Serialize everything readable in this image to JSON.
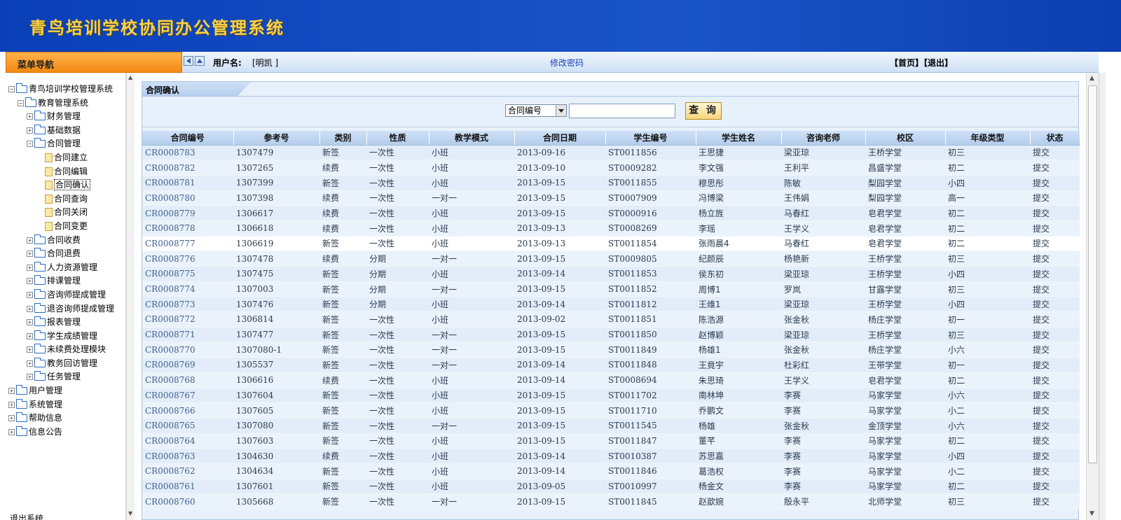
{
  "app": {
    "title": "青鸟培训学校协同办公管理系统"
  },
  "sidebar": {
    "header": "菜单导航",
    "tree": [
      {
        "label": "青鸟培训学校管理系统",
        "level": 0,
        "toggle": "−",
        "icon": "folder"
      },
      {
        "label": "教育管理系统",
        "level": 1,
        "toggle": "−",
        "icon": "folder"
      },
      {
        "label": "财务管理",
        "level": 2,
        "toggle": "+",
        "icon": "folder"
      },
      {
        "label": "基础数据",
        "level": 2,
        "toggle": "+",
        "icon": "folder"
      },
      {
        "label": "合同管理",
        "level": 2,
        "toggle": "−",
        "icon": "folder"
      },
      {
        "label": "合同建立",
        "level": 3,
        "toggle": "",
        "icon": "doc"
      },
      {
        "label": "合同编辑",
        "level": 3,
        "toggle": "",
        "icon": "doc"
      },
      {
        "label": "合同确认",
        "level": 3,
        "toggle": "",
        "icon": "doc",
        "selected": true
      },
      {
        "label": "合同查询",
        "level": 3,
        "toggle": "",
        "icon": "doc"
      },
      {
        "label": "合同关闭",
        "level": 3,
        "toggle": "",
        "icon": "doc"
      },
      {
        "label": "合同变更",
        "level": 3,
        "toggle": "",
        "icon": "doc"
      },
      {
        "label": "合同收费",
        "level": 2,
        "toggle": "+",
        "icon": "folder"
      },
      {
        "label": "合同退费",
        "level": 2,
        "toggle": "+",
        "icon": "folder"
      },
      {
        "label": "人力资源管理",
        "level": 2,
        "toggle": "+",
        "icon": "folder"
      },
      {
        "label": "排课管理",
        "level": 2,
        "toggle": "+",
        "icon": "folder"
      },
      {
        "label": "咨询师提成管理",
        "level": 2,
        "toggle": "+",
        "icon": "folder"
      },
      {
        "label": "退咨询师提成管理",
        "level": 2,
        "toggle": "+",
        "icon": "folder"
      },
      {
        "label": "报表管理",
        "level": 2,
        "toggle": "+",
        "icon": "folder"
      },
      {
        "label": "学生成绩管理",
        "level": 2,
        "toggle": "+",
        "icon": "folder"
      },
      {
        "label": "未续费处理模块",
        "level": 2,
        "toggle": "+",
        "icon": "folder"
      },
      {
        "label": "教务回访管理",
        "level": 2,
        "toggle": "+",
        "icon": "folder"
      },
      {
        "label": "任务管理",
        "level": 2,
        "toggle": "+",
        "icon": "folder"
      },
      {
        "label": "用户管理",
        "level": 0,
        "toggle": "+",
        "icon": "folder"
      },
      {
        "label": "系统管理",
        "level": 0,
        "toggle": "+",
        "icon": "folder"
      },
      {
        "label": "帮助信息",
        "level": 0,
        "toggle": "+",
        "icon": "folder"
      },
      {
        "label": "信息公告",
        "level": 0,
        "toggle": "+",
        "icon": "folder"
      }
    ],
    "exit_label": "退出系统"
  },
  "userbar": {
    "user_label": "用户名:",
    "user_name": "[明凯 ]",
    "change_password": "修改密码",
    "home": "【首页】",
    "logout": "【退出】"
  },
  "panel": {
    "title": "合同确认",
    "search_field": "合同编号",
    "search_value": "",
    "query_button": "查 询"
  },
  "table": {
    "columns": [
      "合同编号",
      "参考号",
      "类别",
      "性质",
      "教学模式",
      "合同日期",
      "学生编号",
      "学生姓名",
      "咨询老师",
      "校区",
      "年级类型",
      "状态"
    ],
    "rows": [
      [
        "CR0008783",
        "1307479",
        "新签",
        "一次性",
        "小班",
        "2013-09-16",
        "ST0011856",
        "王思捷",
        "梁亚琼",
        "王桥学堂",
        "初三",
        "提交"
      ],
      [
        "CR0008782",
        "1307265",
        "续费",
        "一次性",
        "小班",
        "2013-09-10",
        "ST0009282",
        "李文强",
        "王利平",
        "昌盛学堂",
        "初二",
        "提交"
      ],
      [
        "CR0008781",
        "1307399",
        "新签",
        "一次性",
        "小班",
        "2013-09-15",
        "ST0011855",
        "穆思彤",
        "陈敏",
        "梨园学堂",
        "小四",
        "提交"
      ],
      [
        "CR0008780",
        "1307398",
        "续费",
        "一次性",
        "一对一",
        "2013-09-15",
        "ST0007909",
        "冯博梁",
        "王伟娟",
        "梨园学堂",
        "高一",
        "提交"
      ],
      [
        "CR0008779",
        "1306617",
        "续费",
        "一次性",
        "小班",
        "2013-09-15",
        "ST0000916",
        "杨立旌",
        "马春红",
        "皂君学堂",
        "初二",
        "提交"
      ],
      [
        "CR0008778",
        "1306618",
        "续费",
        "一次性",
        "小班",
        "2013-09-13",
        "ST0008269",
        "李瑶",
        "王学义",
        "皂君学堂",
        "初二",
        "提交"
      ],
      [
        "CR0008777",
        "1306619",
        "新签",
        "一次性",
        "小班",
        "2013-09-13",
        "ST0011854",
        "张雨晨4",
        "马春红",
        "皂君学堂",
        "初二",
        "提交"
      ],
      [
        "CR0008776",
        "1307478",
        "续费",
        "分期",
        "一对一",
        "2013-09-15",
        "ST0009805",
        "纪颜辰",
        "杨艳新",
        "王桥学堂",
        "初三",
        "提交"
      ],
      [
        "CR0008775",
        "1307475",
        "新签",
        "分期",
        "小班",
        "2013-09-14",
        "ST0011853",
        "侯东初",
        "梁亚琼",
        "王桥学堂",
        "小四",
        "提交"
      ],
      [
        "CR0008774",
        "1307003",
        "新签",
        "分期",
        "一对一",
        "2013-09-15",
        "ST0011852",
        "周博1",
        "罗岚",
        "甘露学堂",
        "初三",
        "提交"
      ],
      [
        "CR0008773",
        "1307476",
        "新签",
        "分期",
        "小班",
        "2013-09-14",
        "ST0011812",
        "王维1",
        "梁亚琼",
        "王桥学堂",
        "小四",
        "提交"
      ],
      [
        "CR0008772",
        "1306814",
        "新签",
        "一次性",
        "小班",
        "2013-09-02",
        "ST0011851",
        "陈浩源",
        "张金秋",
        "杨庄学堂",
        "初一",
        "提交"
      ],
      [
        "CR0008771",
        "1307477",
        "新签",
        "一次性",
        "一对一",
        "2013-09-15",
        "ST0011850",
        "赵博颖",
        "梁亚琼",
        "王桥学堂",
        "初三",
        "提交"
      ],
      [
        "CR0008770",
        "1307080-1",
        "新签",
        "一次性",
        "一对一",
        "2013-09-15",
        "ST0011849",
        "杨雄1",
        "张金秋",
        "杨庄学堂",
        "小六",
        "提交"
      ],
      [
        "CR0008769",
        "1305537",
        "新签",
        "一次性",
        "一对一",
        "2013-09-14",
        "ST0011848",
        "王竟宇",
        "杜彩红",
        "王带学堂",
        "初一",
        "提交"
      ],
      [
        "CR0008768",
        "1306616",
        "续费",
        "一次性",
        "小班",
        "2013-09-14",
        "ST0008694",
        "朱思琦",
        "王学义",
        "皂君学堂",
        "初二",
        "提交"
      ],
      [
        "CR0008767",
        "1307604",
        "新签",
        "一次性",
        "小班",
        "2013-09-15",
        "ST0011702",
        "南林坤",
        "李赛",
        "马家学堂",
        "小六",
        "提交"
      ],
      [
        "CR0008766",
        "1307605",
        "新签",
        "一次性",
        "小班",
        "2013-09-15",
        "ST0011710",
        "乔鹏文",
        "李赛",
        "马家学堂",
        "小二",
        "提交"
      ],
      [
        "CR0008765",
        "1307080",
        "新签",
        "一次性",
        "一对一",
        "2013-09-15",
        "ST0011545",
        "杨雄",
        "张金秋",
        "金顶学堂",
        "小六",
        "提交"
      ],
      [
        "CR0008764",
        "1307603",
        "新签",
        "一次性",
        "小班",
        "2013-09-15",
        "ST0011847",
        "董芊",
        "李赛",
        "马家学堂",
        "初二",
        "提交"
      ],
      [
        "CR0008763",
        "1304630",
        "续费",
        "一次性",
        "小班",
        "2013-09-14",
        "ST0010387",
        "苏思嘉",
        "李赛",
        "马家学堂",
        "小四",
        "提交"
      ],
      [
        "CR0008762",
        "1304634",
        "新签",
        "一次性",
        "小班",
        "2013-09-14",
        "ST0011846",
        "葛浩权",
        "李赛",
        "马家学堂",
        "小二",
        "提交"
      ],
      [
        "CR0008761",
        "1307601",
        "新签",
        "一次性",
        "小班",
        "2013-09-05",
        "ST0010997",
        "杨金文",
        "李赛",
        "马家学堂",
        "初二",
        "提交"
      ],
      [
        "CR0008760",
        "1305668",
        "新签",
        "一次性",
        "一对一",
        "2013-09-15",
        "ST0011845",
        "赵歆婉",
        "殷永平",
        "北师学堂",
        "初三",
        "提交"
      ]
    ],
    "highlight_row": 6
  },
  "colors": {
    "banner": "#0a3fb8",
    "banner_title": "#f7d24a",
    "sidebar_header": "#f38a14",
    "row_odd": "#e2edf9",
    "row_even": "#eaf2fb"
  }
}
